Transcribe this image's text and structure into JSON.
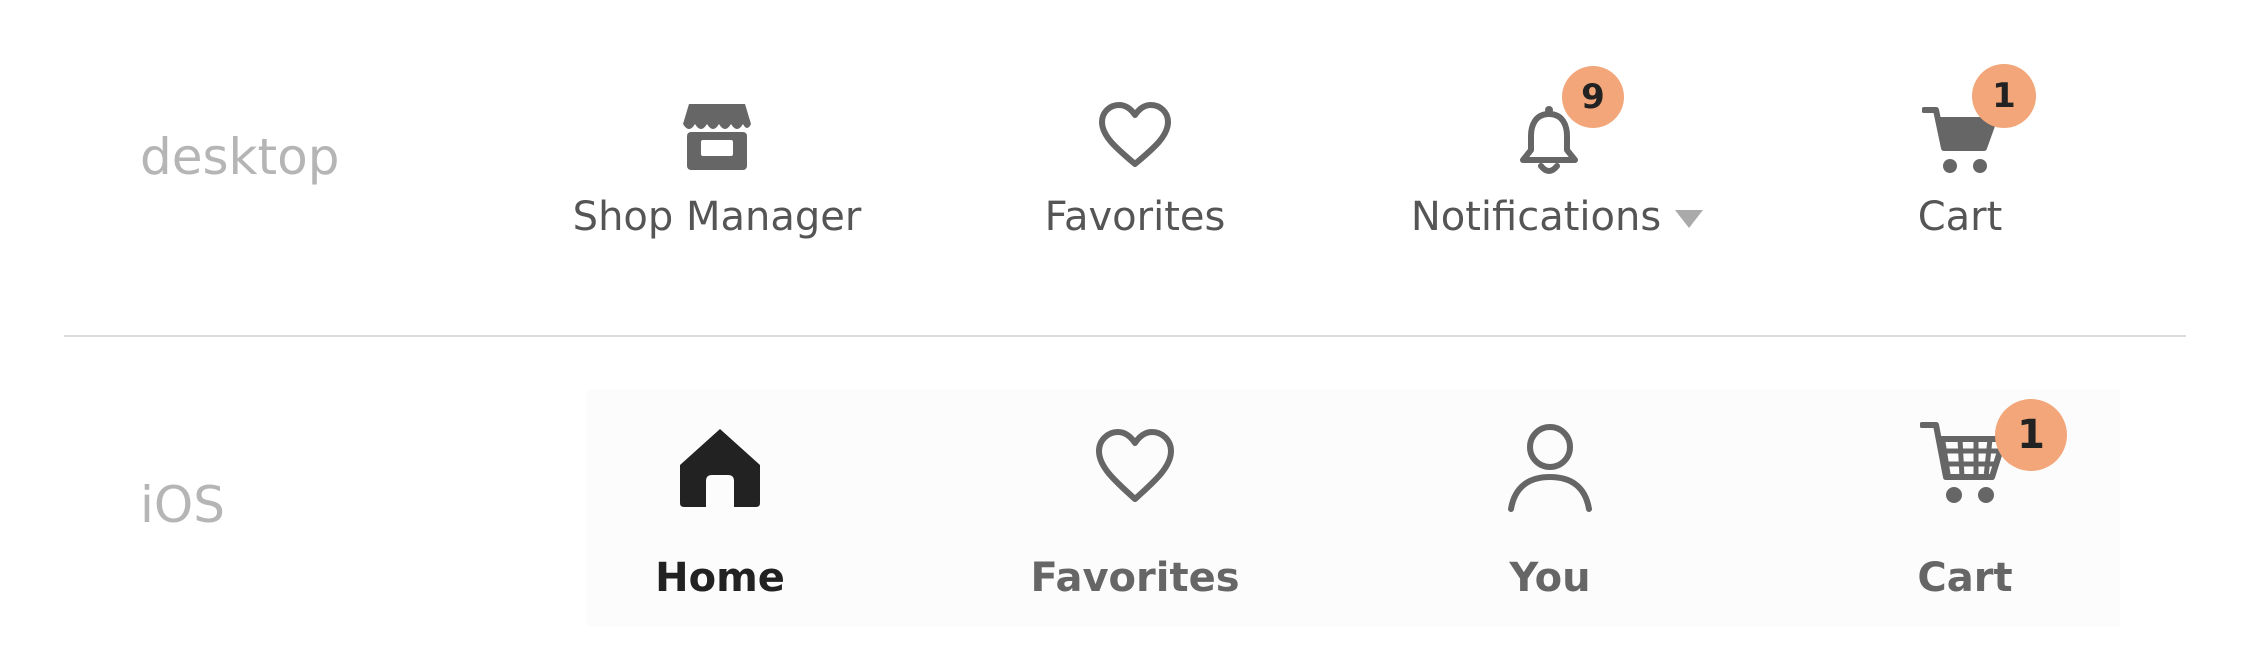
{
  "colors": {
    "badge": "#f2a679",
    "icon": "#666666",
    "icon_active": "#222222",
    "platform_label": "#b5b5b5"
  },
  "desktop": {
    "platform_label": "desktop",
    "items": [
      {
        "label": "Shop Manager",
        "icon": "storefront-icon"
      },
      {
        "label": "Favorites",
        "icon": "heart-icon"
      },
      {
        "label": "Notifications",
        "icon": "bell-icon",
        "badge": "9",
        "dropdown": "caret-down-icon"
      },
      {
        "label": "Cart",
        "icon": "cart-icon",
        "badge": "1"
      }
    ]
  },
  "ios": {
    "platform_label": "iOS",
    "items": [
      {
        "label": "Home",
        "icon": "home-icon",
        "active": true
      },
      {
        "label": "Favorites",
        "icon": "heart-icon"
      },
      {
        "label": "You",
        "icon": "person-icon"
      },
      {
        "label": "Cart",
        "icon": "cart-icon",
        "badge": "1"
      }
    ]
  }
}
